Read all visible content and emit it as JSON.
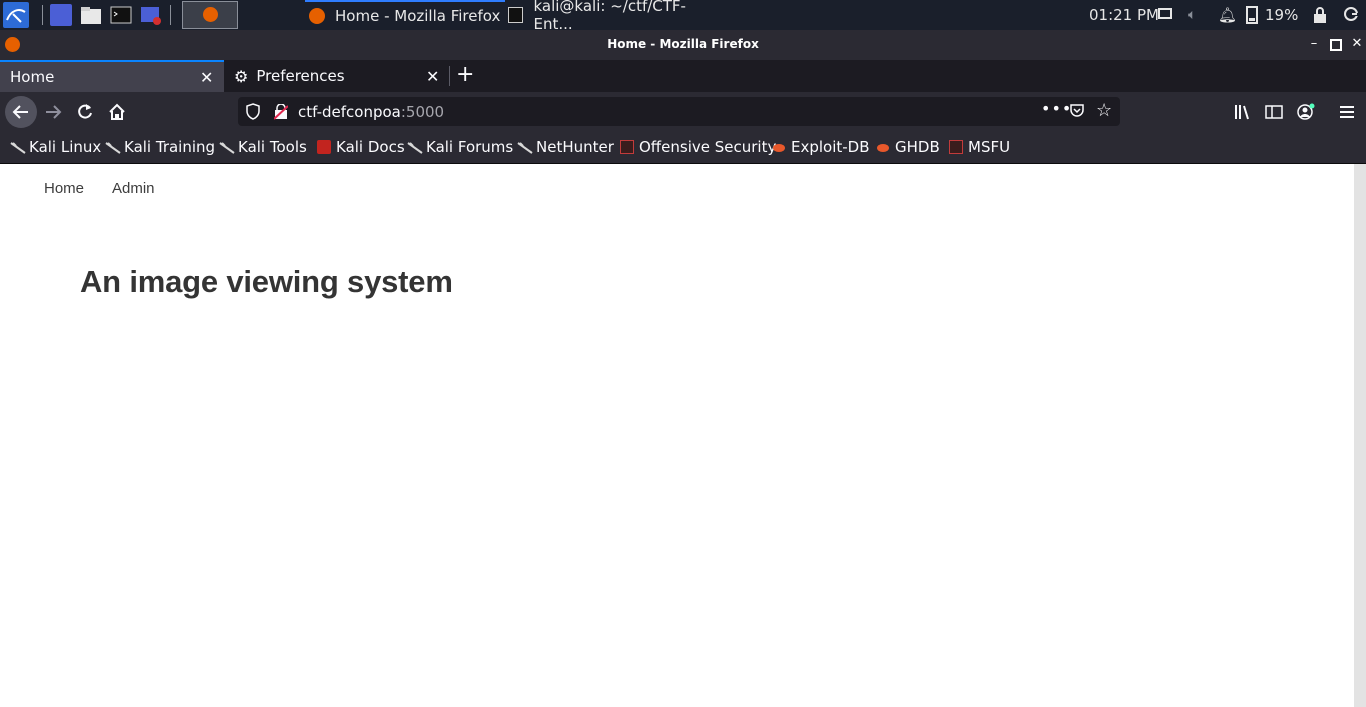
{
  "taskbar": {
    "tasks": [
      {
        "label": "Home - Mozilla Firefox"
      },
      {
        "label": "kali@kali: ~/ctf/CTF-Ent..."
      }
    ],
    "clock": "01:21 PM",
    "battery": "19%"
  },
  "window": {
    "title": "Home - Mozilla Firefox"
  },
  "tabs": [
    {
      "label": "Home"
    },
    {
      "label": "Preferences"
    }
  ],
  "urlbar": {
    "host": "ctf-defconpoa",
    "port": ":5000"
  },
  "bookmarks": [
    {
      "label": "Kali Linux"
    },
    {
      "label": "Kali Training"
    },
    {
      "label": "Kali Tools"
    },
    {
      "label": "Kali Docs"
    },
    {
      "label": "Kali Forums"
    },
    {
      "label": "NetHunter"
    },
    {
      "label": "Offensive Security"
    },
    {
      "label": "Exploit-DB"
    },
    {
      "label": "GHDB"
    },
    {
      "label": "MSFU"
    }
  ],
  "page": {
    "nav": [
      {
        "label": "Home"
      },
      {
        "label": "Admin"
      }
    ],
    "heading": "An image viewing system"
  },
  "colors": {
    "taskbar_bg": "#1a1f2b",
    "toolbar_bg": "#2b2a33",
    "tab_strip_bg": "#1c1b22",
    "active_tab_accent": "#0a84ff"
  }
}
